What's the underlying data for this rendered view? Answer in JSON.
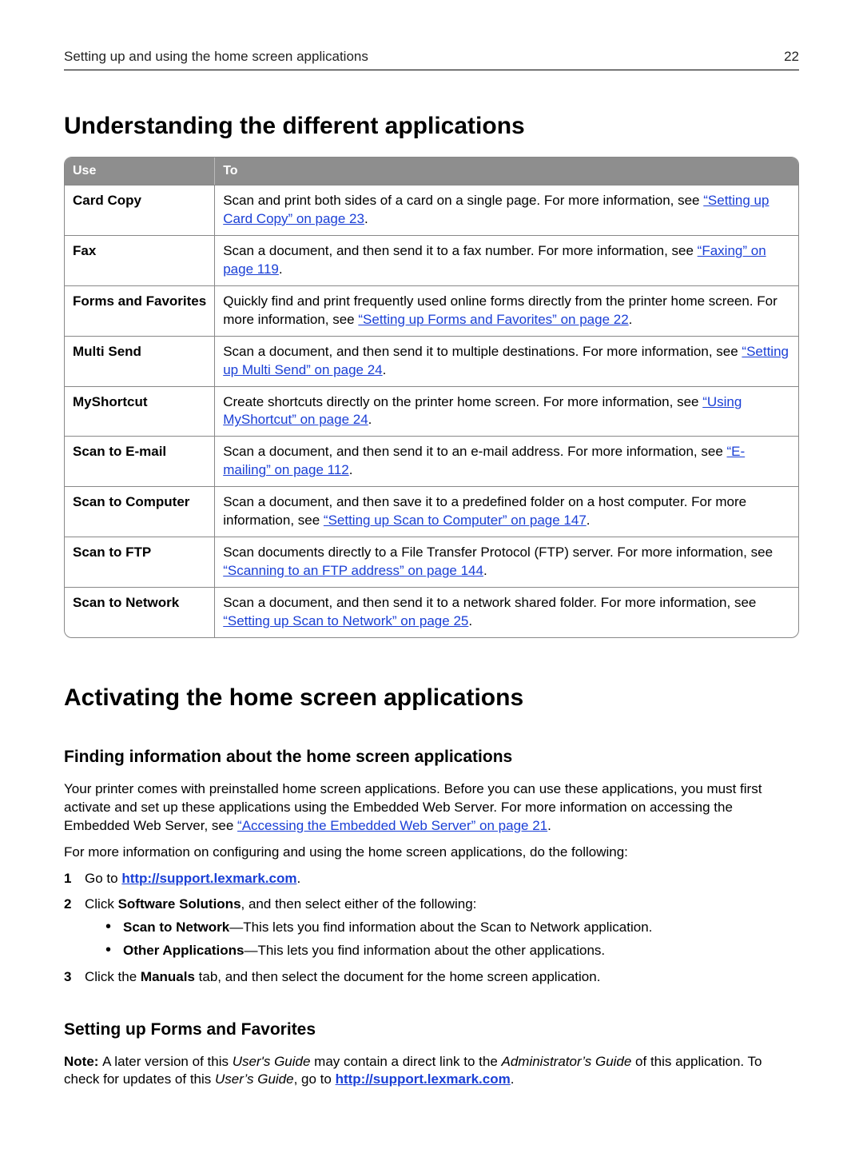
{
  "header": {
    "section": "Setting up and using the home screen applications",
    "page_number": "22"
  },
  "h1_understanding": "Understanding the different applications",
  "table": {
    "head_use": "Use",
    "head_to": "To",
    "rows": [
      {
        "name": "Card Copy",
        "pre": "Scan and print both sides of a card on a single page. For more information, see ",
        "link": "“Setting up Card Copy” on page 23",
        "post": "."
      },
      {
        "name": "Fax",
        "pre": "Scan a document, and then send it to a fax number. For more information, see ",
        "link": "“Faxing” on page 119",
        "post": "."
      },
      {
        "name": "Forms and Favorites",
        "pre": "Quickly find and print frequently used online forms directly from the printer home screen. For more information, see ",
        "link": "“Setting up Forms and Favorites” on page 22",
        "post": "."
      },
      {
        "name": "Multi Send",
        "pre": "Scan a document, and then send it to multiple destinations. For more information, see ",
        "link": "“Setting up Multi Send” on page 24",
        "post": "."
      },
      {
        "name": "MyShortcut",
        "pre": "Create shortcuts directly on the printer home screen. For more information, see ",
        "link": "“Using MyShortcut” on page 24",
        "post": "."
      },
      {
        "name": "Scan to E-mail",
        "pre": "Scan a document, and then send it to an e-mail address. For more information, see ",
        "link": "“E-mailing” on page 112",
        "post": "."
      },
      {
        "name": "Scan to Computer",
        "pre": "Scan a document, and then save it to a predefined folder on a host computer. For more information, see ",
        "link": "“Setting up Scan to Computer” on page 147",
        "post": "."
      },
      {
        "name": "Scan to FTP",
        "pre": "Scan documents directly to a File Transfer Protocol (FTP) server. For more information, see ",
        "link": "“Scanning to an FTP address” on page 144",
        "post": "."
      },
      {
        "name": "Scan to Network",
        "pre": "Scan a document, and then send it to a network shared folder. For more information, see ",
        "link": "“Setting up Scan to Network” on page 25",
        "post": "."
      }
    ]
  },
  "h1_activating": "Activating the home screen applications",
  "h2_finding": "Finding information about the home screen applications",
  "finding_para": {
    "pre": "Your printer comes with preinstalled home screen applications. Before you can use these applications, you must first activate and set up these applications using the Embedded Web Server. For more information on accessing the Embedded Web Server, see ",
    "link": "“Accessing the Embedded Web Server” on page 21",
    "post": "."
  },
  "more_info_para": "For more information on configuring and using the home screen applications, do the following:",
  "step1": {
    "num": "1",
    "pre": "Go to ",
    "link": "http://support.lexmark.com",
    "post": "."
  },
  "step2": {
    "num": "2",
    "pre": "Click ",
    "bold": "Software Solutions",
    "post": ", and then select either of the following:"
  },
  "bullet_a": {
    "bold": "Scan to Network",
    "post": "—This lets you find information about the Scan to Network application."
  },
  "bullet_b": {
    "bold": "Other Applications",
    "post": "—This lets you find information about the other applications."
  },
  "step3": {
    "num": "3",
    "pre": "Click the ",
    "bold": "Manuals",
    "post": " tab, and then select the document for the home screen application."
  },
  "h2_forms": "Setting up Forms and Favorites",
  "forms_note": {
    "lead": "Note: ",
    "t1": "A later version of this ",
    "i1": "User's Guide",
    "t2": " may contain a direct link to the ",
    "i2": "Administrator’s Guide",
    "t3": " of this application. To check for updates of this ",
    "i3": "User’s Guide",
    "t4": ", go to ",
    "link": "http://support.lexmark.com",
    "t5": "."
  }
}
